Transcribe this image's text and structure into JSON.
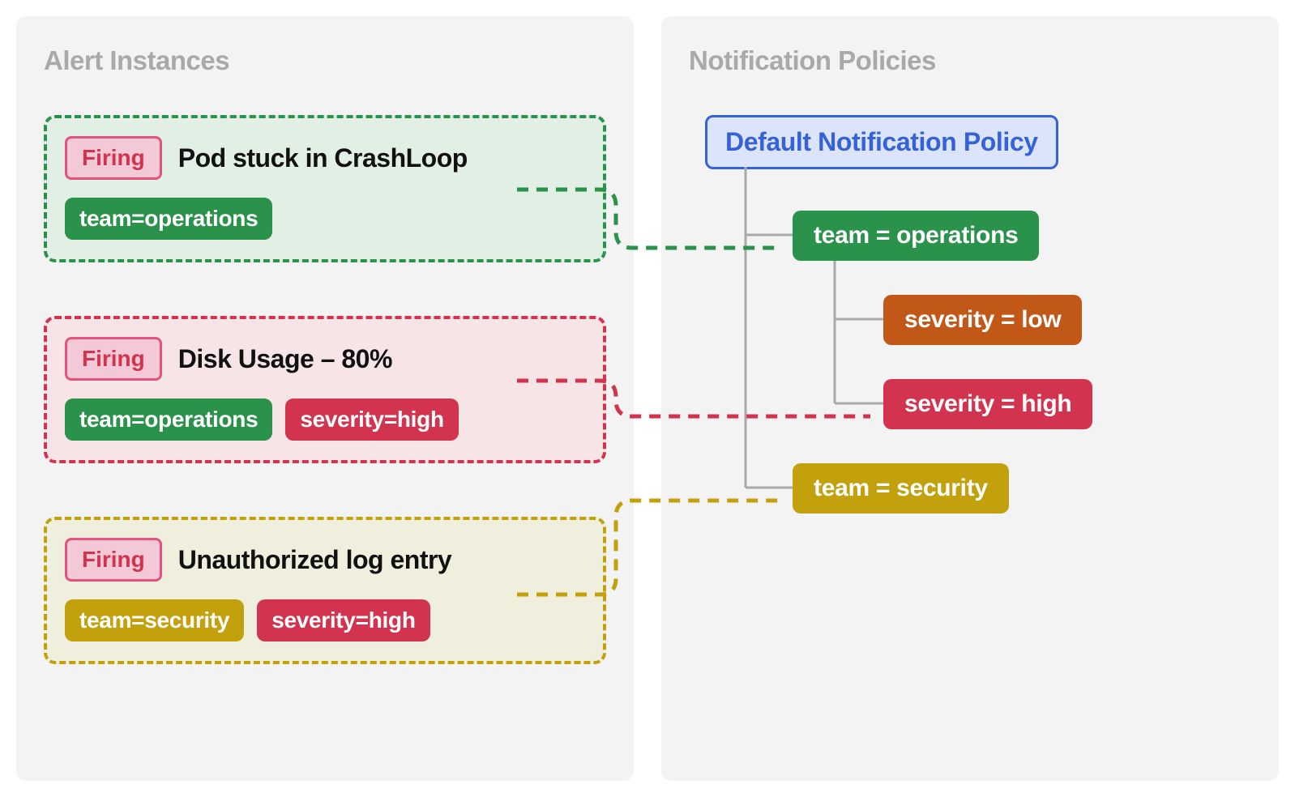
{
  "left_title": "Alert Instances",
  "right_title": "Notification Policies",
  "default_policy": "Default Notification Policy",
  "firing_label": "Firing",
  "alerts": [
    {
      "title": "Pod stuck in CrashLoop",
      "tags": [
        {
          "text": "team=operations",
          "color": "green"
        }
      ],
      "card_color": "green"
    },
    {
      "title": "Disk Usage – 80%",
      "tags": [
        {
          "text": "team=operations",
          "color": "green"
        },
        {
          "text": "severity=high",
          "color": "red"
        }
      ],
      "card_color": "red"
    },
    {
      "title": "Unauthorized log entry",
      "tags": [
        {
          "text": "team=security",
          "color": "gold"
        },
        {
          "text": "severity=high",
          "color": "red"
        }
      ],
      "card_color": "gold"
    }
  ],
  "policy_tree": {
    "team_operations": "team = operations",
    "severity_low": "severity = low",
    "severity_high": "severity = high",
    "team_security": "team = security"
  },
  "colors": {
    "green": "#2b924b",
    "red": "#d2334e",
    "gold": "#c2a10c",
    "orange": "#c15818",
    "blue": "#3662d8",
    "grey_line": "#a9a9a9"
  }
}
